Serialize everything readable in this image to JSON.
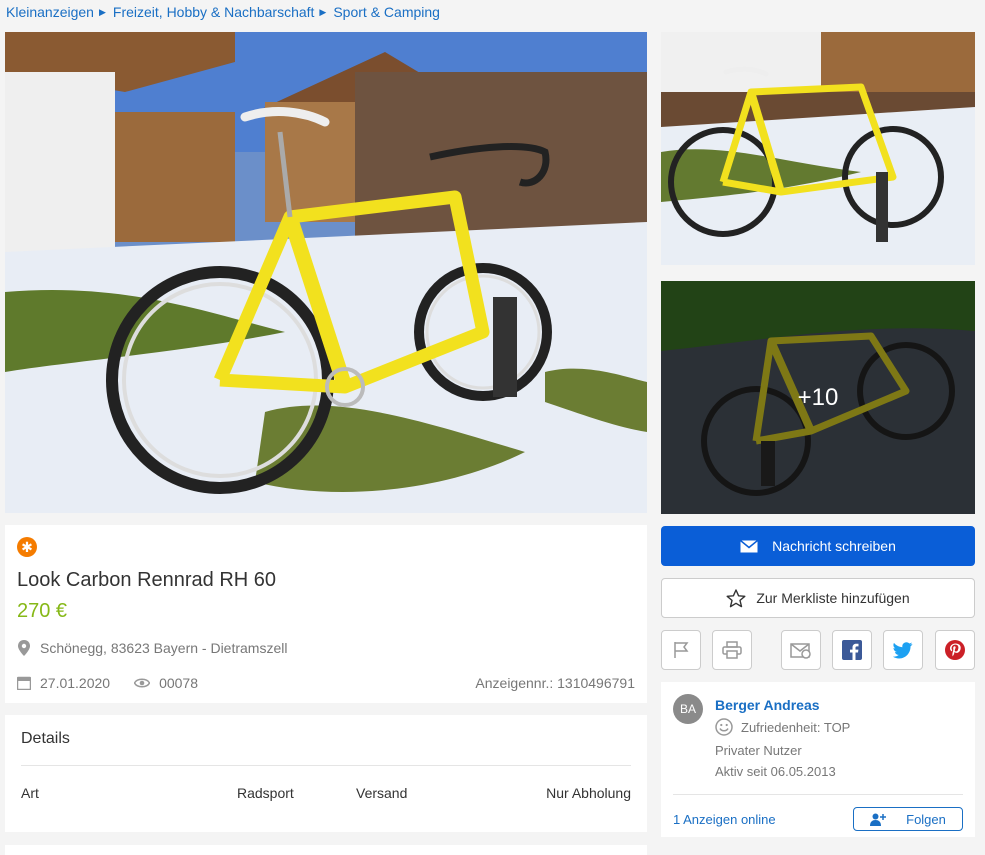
{
  "breadcrumb": [
    "Kleinanzeigen",
    "Freizeit, Hobby & Nachbarschaft",
    "Sport & Camping"
  ],
  "gallery": {
    "more_label": "+10"
  },
  "listing": {
    "badge_icon": "top-ad-icon",
    "title": "Look Carbon Rennrad RH 60",
    "price": "270 €",
    "location": "Schönegg, 83623 Bayern - Dietramszell",
    "date": "27.01.2020",
    "views": "00078",
    "ad_id": "Anzeigennr.: 1310496791"
  },
  "details": {
    "heading": "Details",
    "rows": [
      {
        "label": "Art",
        "value": "Radsport"
      },
      {
        "label": "Versand",
        "value": "Nur Abholung"
      }
    ]
  },
  "actions": {
    "message_label": "Nachricht schreiben",
    "watchlist_label": "Zur Merkliste hinzufügen",
    "icons": [
      "flag-icon",
      "print-icon",
      "email-share-icon",
      "facebook-icon",
      "twitter-icon",
      "pinterest-icon"
    ]
  },
  "seller": {
    "initials": "BA",
    "name": "Berger Andreas",
    "rating": "Zufriedenheit: TOP",
    "type": "Privater Nutzer",
    "since": "Aktiv seit 06.05.2013",
    "ads_online": "1 Anzeigen online",
    "follow_label": "Folgen"
  },
  "colors": {
    "link": "#1a6fc4",
    "primary_button": "#0a5ed7",
    "price": "#86b817",
    "badge": "#f57c00",
    "facebook": "#3b5998",
    "twitter": "#1da1f2",
    "pinterest": "#cb2027"
  }
}
